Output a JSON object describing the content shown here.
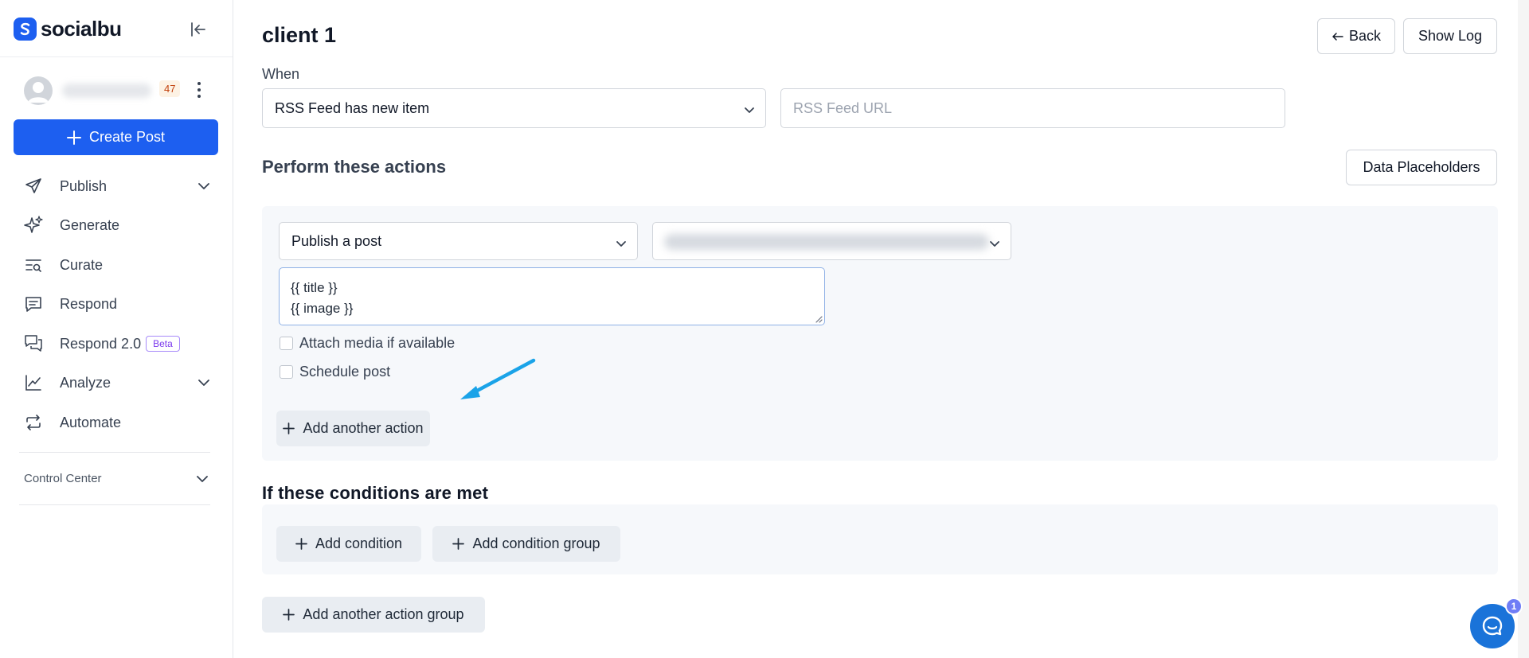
{
  "brand": {
    "name": "socialbu"
  },
  "user": {
    "notification_count": "47"
  },
  "sidebar": {
    "create_post_label": "Create Post",
    "items": [
      {
        "label": "Publish",
        "icon": "send-icon",
        "expandable": true
      },
      {
        "label": "Generate",
        "icon": "sparkle-icon",
        "expandable": false
      },
      {
        "label": "Curate",
        "icon": "curate-icon",
        "expandable": false
      },
      {
        "label": "Respond",
        "icon": "message-icon",
        "expandable": false
      },
      {
        "label": "Respond 2.0",
        "icon": "chat-icon",
        "badge": "Beta",
        "expandable": false
      },
      {
        "label": "Analyze",
        "icon": "chart-icon",
        "expandable": true
      },
      {
        "label": "Automate",
        "icon": "repeat-icon",
        "expandable": false
      }
    ],
    "control_center_label": "Control Center"
  },
  "header": {
    "title": "client 1",
    "back_label": "Back",
    "show_log_label": "Show Log"
  },
  "when": {
    "label": "When",
    "trigger_value": "RSS Feed has new item",
    "feed_url_placeholder": "RSS Feed URL"
  },
  "actions": {
    "heading": "Perform these actions",
    "data_placeholders_label": "Data Placeholders",
    "action_type_value": "Publish a post",
    "content_lines": [
      "{{ title }}",
      "{{ image }}"
    ],
    "attach_media_label": "Attach media if available",
    "schedule_post_label": "Schedule post",
    "add_action_label": "Add another action"
  },
  "conditions": {
    "heading": "If these conditions are met",
    "add_condition_label": "Add condition",
    "add_condition_group_label": "Add condition group"
  },
  "add_action_group_label": "Add another action group",
  "chat": {
    "badge_count": "1"
  },
  "colors": {
    "primary": "#1d5ff0",
    "annotation_arrow": "#1aa3e8",
    "panel_bg": "#f6f8fb"
  }
}
